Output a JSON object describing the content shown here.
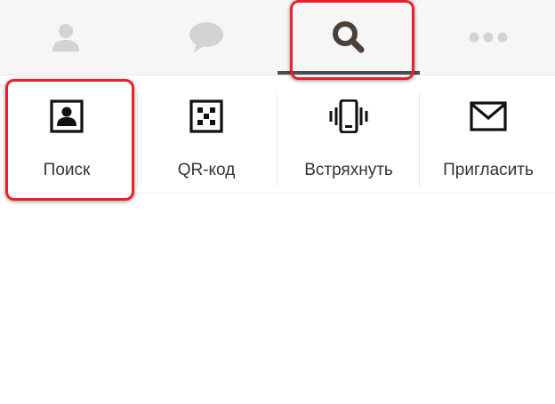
{
  "tabs": [
    {
      "id": "contacts",
      "icon": "person-icon",
      "active": false
    },
    {
      "id": "chats",
      "icon": "chat-bubble-icon",
      "active": false
    },
    {
      "id": "search",
      "icon": "search-icon",
      "active": true
    },
    {
      "id": "more",
      "icon": "more-dots-icon",
      "active": false
    }
  ],
  "actions": {
    "find": {
      "label": "Поиск",
      "icon": "contact-card-icon"
    },
    "qr": {
      "label": "QR-код",
      "icon": "qr-code-icon"
    },
    "shake": {
      "label": "Встряхнуть",
      "icon": "vibrating-phone-icon"
    },
    "invite": {
      "label": "Пригласить",
      "icon": "envelope-icon"
    }
  },
  "colors": {
    "tab_inactive": "#d3d3d3",
    "tab_active": "#4f4036",
    "highlight": "#e8212b",
    "label_text": "#333333"
  }
}
